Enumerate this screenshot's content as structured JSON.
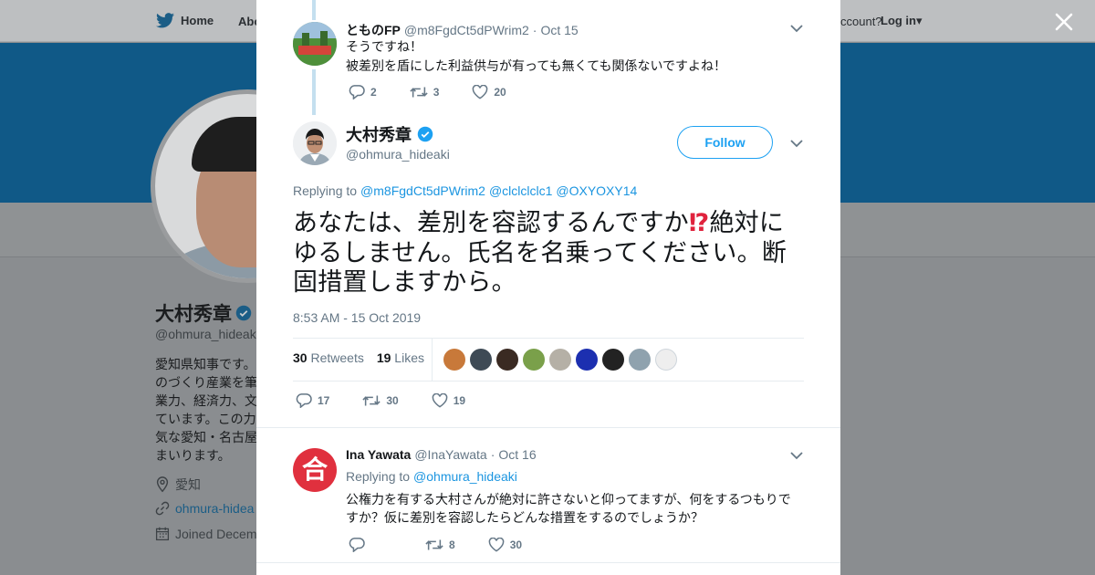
{
  "nav": {
    "home": "Home",
    "about_partial": "Abo",
    "account_partial": "ccount?",
    "login": "Log in"
  },
  "profile": {
    "name": "大村秀章",
    "handle": "@ohmura_hideaki",
    "bio": "愛知県知事です。\nのづくり産業を筆\n業力、経済力、文\nています。この力\n気な愛知・名古屋\nまいります。",
    "location": "愛知",
    "website": "ohmura-hidea",
    "joined": "Joined Decem"
  },
  "reply_top": {
    "name": "とものFP",
    "handle": "@m8FgdCt5dPWrim2",
    "date": "Oct 15",
    "line1": "そうですね！",
    "line2": "被差別を盾にした利益供与が有っても無くても関係ないですよね！",
    "replies": "2",
    "retweets": "3",
    "likes": "20"
  },
  "main_tweet": {
    "name": "大村秀章",
    "handle": "@ohmura_hideaki",
    "follow_label": "Follow",
    "replying_prefix": "Replying to",
    "replying_1": "@m8FgdCt5dPWrim2",
    "replying_2": "@clclclclc1",
    "replying_3": "@OXYOXY14",
    "text_before": "あなたは、差別を容認するんですか",
    "text_emoji": "⁉",
    "text_after": "絶対にゆるしません。氏名を名乗ってください。断固措置しますから。",
    "timestamp": "8:53 AM - 15 Oct 2019",
    "retweets_count": "30",
    "retweets_label": "Retweets",
    "likes_count": "19",
    "likes_label": "Likes",
    "replies": "17",
    "retweets": "30",
    "likes": "19",
    "liker_colors": [
      "#c8793a",
      "#3e4a55",
      "#3a2a22",
      "#7aa04a",
      "#b5b0a6",
      "#1c2fb0",
      "#222222",
      "#8fa2ae",
      "#eeeeee"
    ]
  },
  "reply_bottom": {
    "name": "Ina Yawata",
    "handle": "@InaYawata",
    "date": "Oct 16",
    "avatar_glyph": "合",
    "replying_prefix": "Replying to",
    "replying_1": "@ohmura_hideaki",
    "text": "公権力を有する大村さんが絶対に許さないと仰ってますが、何をするつもりですか？仮に差別を容認したらどんな措置をするのでしょうか？",
    "replies": "",
    "retweets": "8",
    "likes": "30"
  },
  "colors": {
    "accent": "#1da1f2",
    "link": "#1b95e0",
    "verified": "#1da1f2",
    "banner": "#105987"
  }
}
